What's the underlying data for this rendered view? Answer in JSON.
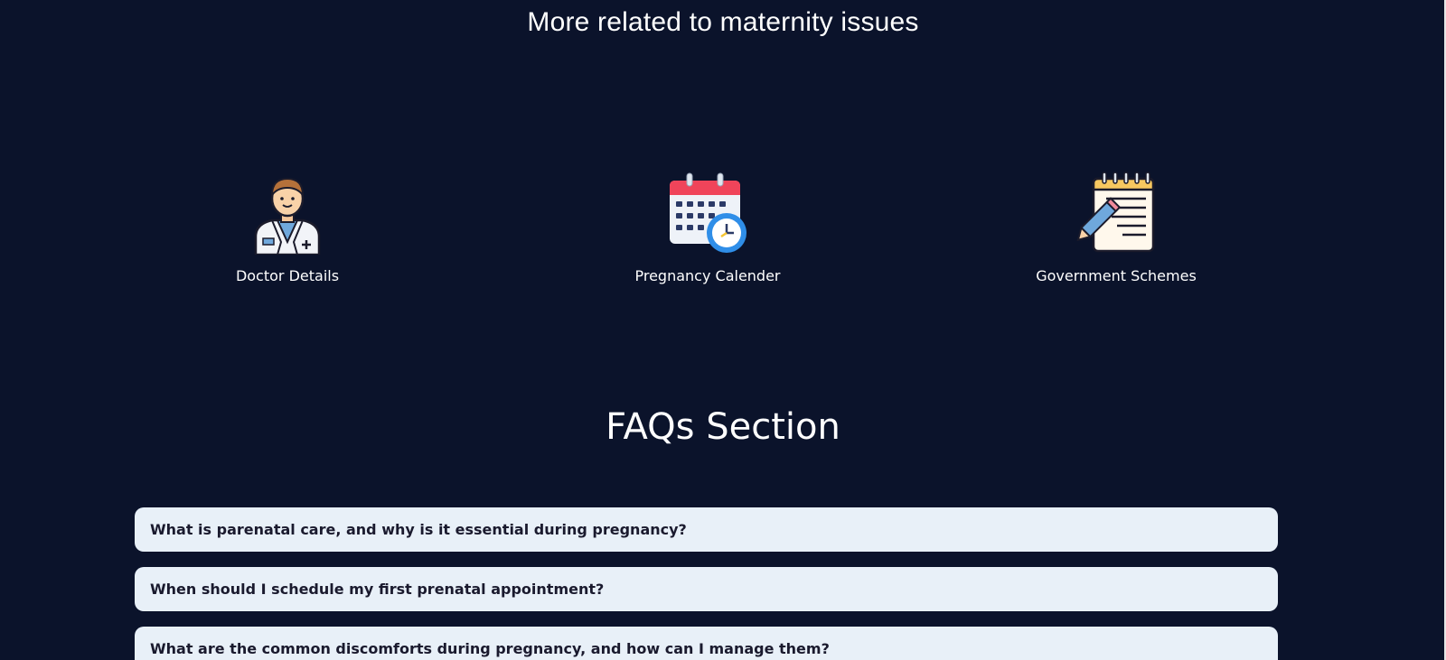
{
  "related": {
    "title": "More related to maternity issues",
    "cards": [
      {
        "label": "Doctor Details",
        "icon": "doctor-icon"
      },
      {
        "label": "Pregnancy Calender",
        "icon": "calendar-clock-icon"
      },
      {
        "label": "Government Schemes",
        "icon": "notepad-pencil-icon"
      }
    ]
  },
  "faq": {
    "title": "FAQs Section",
    "items": [
      {
        "question": "What is parenatal care, and why is it essential during pregnancy?"
      },
      {
        "question": "When should I schedule my first prenatal appointment?"
      },
      {
        "question": "What are the common discomforts during pregnancy, and how can I manage them?"
      }
    ]
  },
  "colors": {
    "background": "#0b132b",
    "faq_card": "#e8f0f8",
    "faq_text": "#1a1a2e"
  }
}
